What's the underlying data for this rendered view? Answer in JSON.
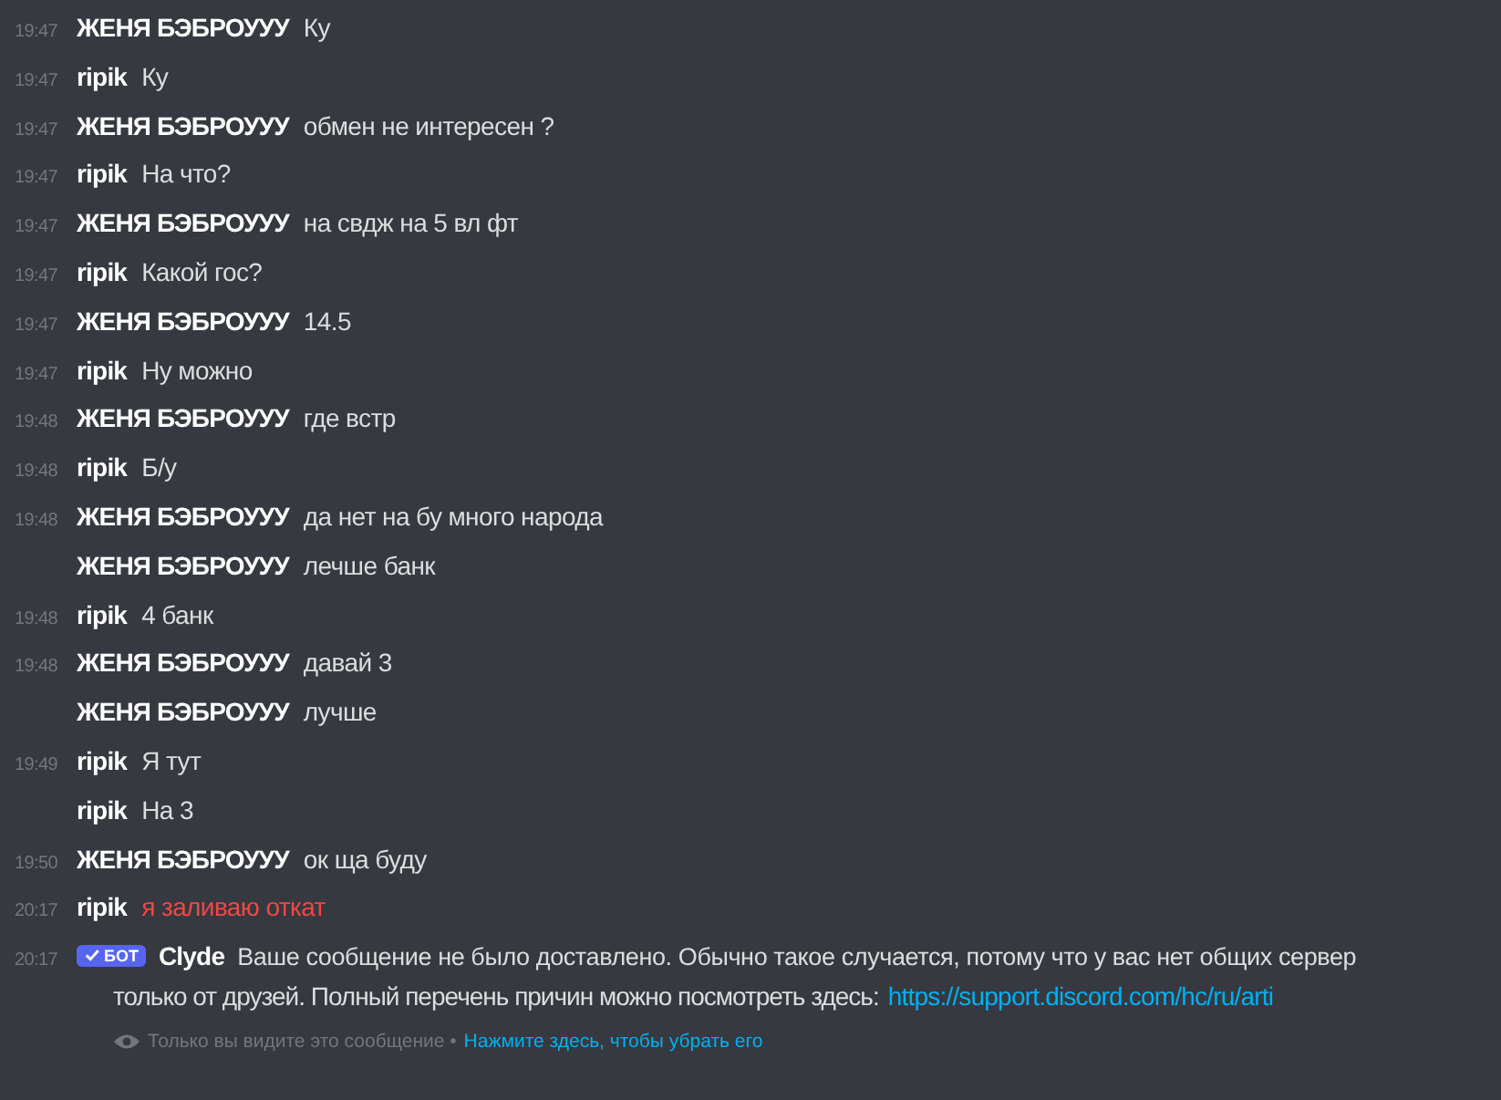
{
  "messages": [
    {
      "time": "19:47",
      "author": "ЖЕНЯ БЭБРОУУУ",
      "text": "Ку",
      "failed": false
    },
    {
      "time": "19:47",
      "author": "ripik",
      "text": "Ку",
      "failed": false
    },
    {
      "time": "19:47",
      "author": "ЖЕНЯ БЭБРОУУУ",
      "text": "обмен не интересен ?",
      "failed": false
    },
    {
      "time": "19:47",
      "author": "ripik",
      "text": "На что?",
      "failed": false
    },
    {
      "time": "19:47",
      "author": "ЖЕНЯ БЭБРОУУУ",
      "text": "на свдж на 5 вл фт",
      "failed": false
    },
    {
      "time": "19:47",
      "author": "ripik",
      "text": "Какой гос?",
      "failed": false
    },
    {
      "time": "19:47",
      "author": "ЖЕНЯ БЭБРОУУУ",
      "text": "14.5",
      "failed": false
    },
    {
      "time": "19:47",
      "author": "ripik",
      "text": "Ну можно",
      "failed": false
    },
    {
      "time": "19:48",
      "author": "ЖЕНЯ БЭБРОУУУ",
      "text": "где встр",
      "failed": false
    },
    {
      "time": "19:48",
      "author": "ripik",
      "text": "Б/у",
      "failed": false
    },
    {
      "time": "19:48",
      "author": "ЖЕНЯ БЭБРОУУУ",
      "text": "да нет на бу много народа",
      "failed": false
    },
    {
      "author": "ЖЕНЯ БЭБРОУУУ",
      "text": "лечше банк",
      "failed": false
    },
    {
      "time": "19:48",
      "author": "ripik",
      "text": "4 банк",
      "failed": false
    },
    {
      "time": "19:48",
      "author": "ЖЕНЯ БЭБРОУУУ",
      "text": "давай 3",
      "failed": false
    },
    {
      "author": "ЖЕНЯ БЭБРОУУУ",
      "text": "лучше",
      "failed": false
    },
    {
      "time": "19:49",
      "author": "ripik",
      "text": "Я тут",
      "failed": false
    },
    {
      "author": "ripik",
      "text": "На 3",
      "failed": false
    },
    {
      "time": "19:50",
      "author": "ЖЕНЯ БЭБРОУУУ",
      "text": "ок ща буду",
      "failed": false
    },
    {
      "time": "20:17",
      "author": "ripik",
      "text": "я заливаю откат",
      "failed": true
    }
  ],
  "bot_message": {
    "time": "20:17",
    "badge": "БОТ",
    "author": "Clyde",
    "line_1": "Ваше сообщение не было доставлено. Обычно такое случается, потому что у вас нет общих сервер",
    "line_2": "только от друзей. Полный перечень причин можно посмотреть здесь:",
    "link": "https://support.discord.com/hc/ru/arti",
    "notice": "Только вы видите это сообщение •",
    "dismiss_link": "Нажмите здесь, чтобы убрать его"
  }
}
